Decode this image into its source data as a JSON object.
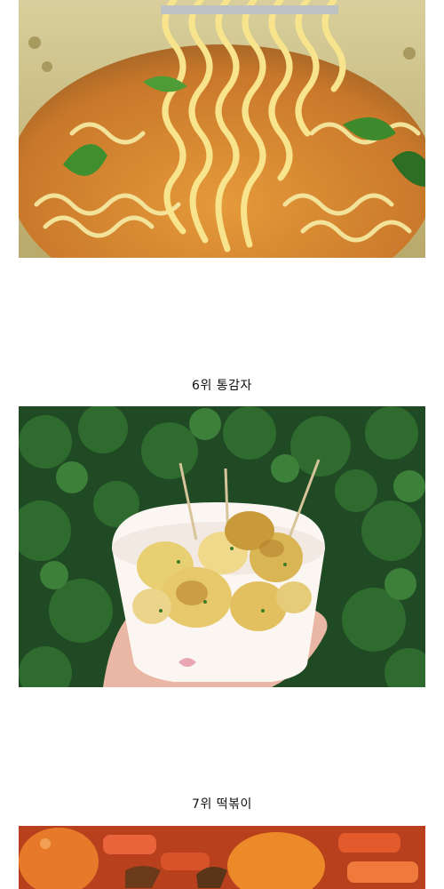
{
  "items": [
    {
      "caption": "",
      "image": "ramen-noodles-photo"
    },
    {
      "caption": "6위 통감자",
      "image": "whole-potatoes-cup-photo"
    },
    {
      "caption": "7위 떡볶이",
      "image": "tteokbokki-photo"
    }
  ]
}
